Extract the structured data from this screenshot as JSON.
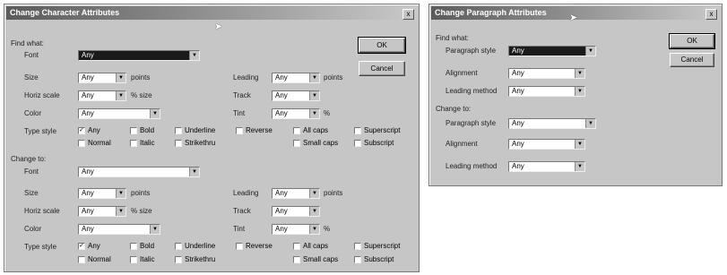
{
  "char_dialog": {
    "title": "Change Character Attributes",
    "close": "x",
    "ok": "OK",
    "cancel": "Cancel",
    "find": {
      "heading": "Find what:",
      "font_label": "Font",
      "font_value": "Any",
      "size_label": "Size",
      "size_value": "Any",
      "size_unit": "points",
      "horiz_label": "Horiz scale",
      "horiz_value": "Any",
      "horiz_unit": "% size",
      "color_label": "Color",
      "color_value": "Any",
      "leading_label": "Leading",
      "leading_value": "Any",
      "leading_unit": "points",
      "track_label": "Track",
      "track_value": "Any",
      "tint_label": "Tint",
      "tint_value": "Any",
      "tint_unit": "%",
      "type_style_label": "Type style",
      "styles": [
        "Any",
        "Bold",
        "Underline",
        "Reverse",
        "All caps",
        "Superscript",
        "Normal",
        "Italic",
        "Strikethru",
        "Small caps",
        "Subscript"
      ]
    },
    "change": {
      "heading": "Change to:",
      "font_label": "Font",
      "font_value": "Any",
      "size_label": "Size",
      "size_value": "Any",
      "size_unit": "points",
      "horiz_label": "Horiz scale",
      "horiz_value": "Any",
      "horiz_unit": "% size",
      "color_label": "Color",
      "color_value": "Any",
      "leading_label": "Leading",
      "leading_value": "Any",
      "leading_unit": "points",
      "track_label": "Track",
      "track_value": "Any",
      "tint_label": "Tint",
      "tint_value": "Any",
      "tint_unit": "%",
      "type_style_label": "Type style",
      "styles": [
        "Any",
        "Bold",
        "Underline",
        "Reverse",
        "All caps",
        "Superscript",
        "Normal",
        "Italic",
        "Strikethru",
        "Small caps",
        "Subscript"
      ]
    }
  },
  "para_dialog": {
    "title": "Change Paragraph Attributes",
    "close": "x",
    "ok": "OK",
    "cancel": "Cancel",
    "find": {
      "heading": "Find what:",
      "style_label": "Paragraph style",
      "style_value": "Any",
      "align_label": "Alignment",
      "align_value": "Any",
      "leading_label": "Leading method",
      "leading_value": "Any"
    },
    "change": {
      "heading": "Change to:",
      "style_label": "Paragraph style",
      "style_value": "Any",
      "align_label": "Alignment",
      "align_value": "Any",
      "leading_label": "Leading method",
      "leading_value": "Any"
    }
  },
  "checked_style": "Any"
}
